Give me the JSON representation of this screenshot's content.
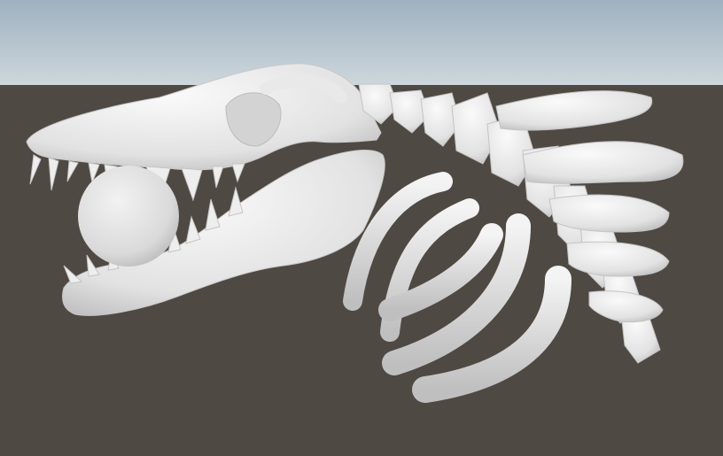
{
  "scene": {
    "sky_top_color": "#9fb1bf",
    "sky_horizon_color": "#cfd8de",
    "ground_color": "#4f4943",
    "model_color": "#efefef",
    "model_shadow_color": "#a9a9a9",
    "sphere_color": "#e6e6e6",
    "objects": [
      "skeleton-skull",
      "sphere",
      "skeleton-spine",
      "skeleton-ribcage"
    ]
  }
}
